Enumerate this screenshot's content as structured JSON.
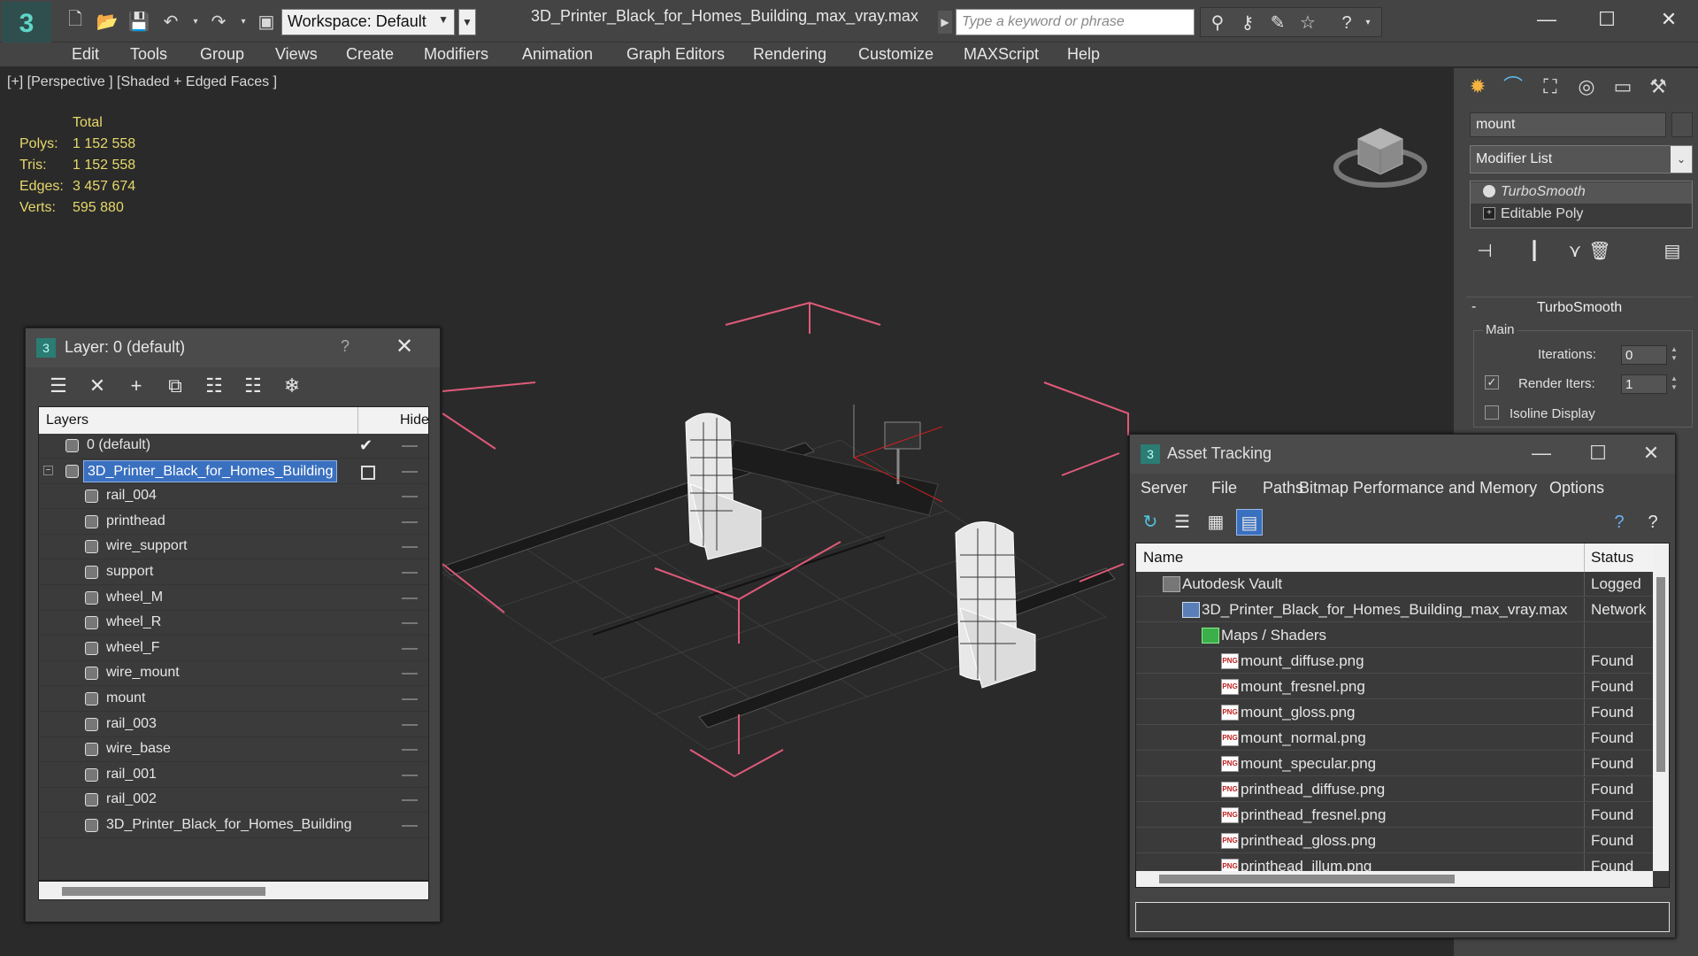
{
  "titlebar": {
    "workspace_label": "Workspace: Default",
    "doc_title": "3D_Printer_Black_for_Homes_Building_max_vray.max",
    "search_placeholder": "Type a keyword or phrase"
  },
  "menu": [
    "Edit",
    "Tools",
    "Group",
    "Views",
    "Create",
    "Modifiers",
    "Animation",
    "Graph Editors",
    "Rendering",
    "Customize",
    "MAXScript",
    "Help"
  ],
  "viewport": {
    "label": "[+] [Perspective ] [Shaded + Edged Faces ]",
    "stats": {
      "header": "Total",
      "polys_label": "Polys:",
      "polys": "1 152 558",
      "tris_label": "Tris:",
      "tris": "1 152 558",
      "edges_label": "Edges:",
      "edges": "3 457 674",
      "verts_label": "Verts:",
      "verts": "595 880"
    }
  },
  "command_panel": {
    "object_name": "mount",
    "modifier_list": "Modifier List",
    "stack": [
      "TurboSmooth",
      "Editable Poly"
    ],
    "rollout_title": "TurboSmooth",
    "group_label": "Main",
    "iterations_label": "Iterations:",
    "iterations_value": "0",
    "render_iters_label": "Render Iters:",
    "render_iters_value": "1",
    "isoline_label": "Isoline Display"
  },
  "layer_dialog": {
    "title": "Layer: 0 (default)",
    "help": "?",
    "col_layers": "Layers",
    "col_hide": "Hide",
    "layers": [
      {
        "name": "0 (default)",
        "level": 0,
        "active": true
      },
      {
        "name": "3D_Printer_Black_for_Homes_Building",
        "level": 0,
        "selected": true
      },
      {
        "name": "rail_004",
        "level": 1
      },
      {
        "name": "printhead",
        "level": 1
      },
      {
        "name": "wire_support",
        "level": 1
      },
      {
        "name": "support",
        "level": 1
      },
      {
        "name": "wheel_M",
        "level": 1
      },
      {
        "name": "wheel_R",
        "level": 1
      },
      {
        "name": "wheel_F",
        "level": 1
      },
      {
        "name": "wire_mount",
        "level": 1
      },
      {
        "name": "mount",
        "level": 1
      },
      {
        "name": "rail_003",
        "level": 1
      },
      {
        "name": "wire_base",
        "level": 1
      },
      {
        "name": "rail_001",
        "level": 1
      },
      {
        "name": "rail_002",
        "level": 1
      },
      {
        "name": "3D_Printer_Black_for_Homes_Building",
        "level": 1
      }
    ]
  },
  "asset_dialog": {
    "title": "Asset Tracking",
    "menu": [
      "Server",
      "File",
      "Paths",
      "Bitmap Performance and Memory",
      "Options"
    ],
    "col_name": "Name",
    "col_status": "Status",
    "rows": [
      {
        "name": "Autodesk Vault",
        "status": "Logged",
        "level": 0,
        "icon": "vault-icon"
      },
      {
        "name": "3D_Printer_Black_for_Homes_Building_max_vray.max",
        "status": "Network",
        "level": 1,
        "icon": "max-file-icon"
      },
      {
        "name": "Maps / Shaders",
        "status": "",
        "level": 2,
        "icon": "maps-folder-icon"
      },
      {
        "name": "mount_diffuse.png",
        "status": "Found",
        "level": 3,
        "icon": "png-icon"
      },
      {
        "name": "mount_fresnel.png",
        "status": "Found",
        "level": 3,
        "icon": "png-icon"
      },
      {
        "name": "mount_gloss.png",
        "status": "Found",
        "level": 3,
        "icon": "png-icon"
      },
      {
        "name": "mount_normal.png",
        "status": "Found",
        "level": 3,
        "icon": "png-icon"
      },
      {
        "name": "mount_specular.png",
        "status": "Found",
        "level": 3,
        "icon": "png-icon"
      },
      {
        "name": "printhead_diffuse.png",
        "status": "Found",
        "level": 3,
        "icon": "png-icon"
      },
      {
        "name": "printhead_fresnel.png",
        "status": "Found",
        "level": 3,
        "icon": "png-icon"
      },
      {
        "name": "printhead_gloss.png",
        "status": "Found",
        "level": 3,
        "icon": "png-icon"
      },
      {
        "name": "printhead_illum.png",
        "status": "Found",
        "level": 3,
        "icon": "png-icon"
      }
    ]
  },
  "colors": {
    "ui_gray": "#444444",
    "viewport_bg": "#2a2a2a",
    "stats_text": "#e6d86a",
    "selection_blue": "#3a70c0",
    "selection_bracket": "#e05a7a"
  }
}
